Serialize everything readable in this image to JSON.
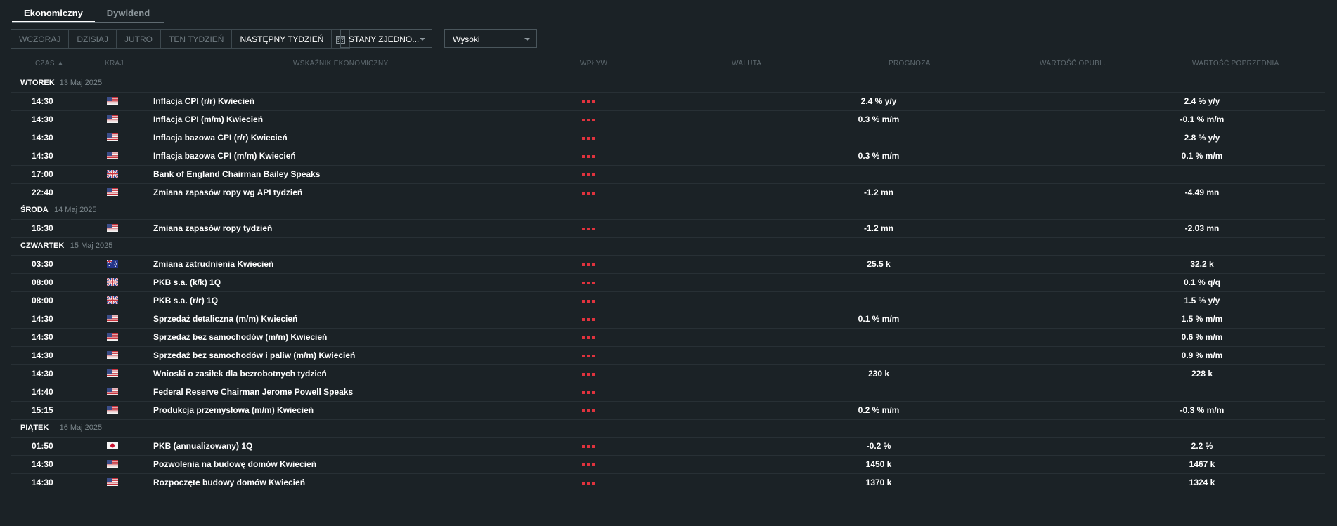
{
  "tabs": [
    "Ekonomiczny",
    "Dywidend"
  ],
  "range": [
    "WCZORAJ",
    "DZISIAJ",
    "JUTRO",
    "TEN TYDZIEŃ",
    "NASTĘPNY TYDZIEŃ"
  ],
  "calendar_icon": "calendar-icon",
  "filters": {
    "country": "STANY ZJEDNO...",
    "importance": "Wysoki"
  },
  "columns": {
    "time": "CZAS ▲",
    "country": "KRAJ",
    "indicator": "WSKAŹNIK EKONOMICZNY",
    "impact": "WPŁYW",
    "currency": "WALUTA",
    "forecast": "PROGNOZA",
    "actual": "WARTOŚĆ OPUBL.",
    "previous": "WARTOŚĆ POPRZEDNIA"
  },
  "colors": {
    "background": "#1b2226",
    "impact": "#e0333e"
  },
  "days": [
    {
      "name": "WTOREK",
      "date": "13 Maj 2025",
      "rows": [
        {
          "time": "14:30",
          "country": "us",
          "indicator": "Inflacja CPI (r/r) Kwiecień",
          "forecast": "2.4 % y/y",
          "previous": "2.4 % y/y"
        },
        {
          "time": "14:30",
          "country": "us",
          "indicator": "Inflacja CPI (m/m) Kwiecień",
          "forecast": "0.3 % m/m",
          "previous": "-0.1 % m/m"
        },
        {
          "time": "14:30",
          "country": "us",
          "indicator": "Inflacja bazowa CPI (r/r) Kwiecień",
          "forecast": "",
          "previous": "2.8 % y/y"
        },
        {
          "time": "14:30",
          "country": "us",
          "indicator": "Inflacja bazowa CPI (m/m) Kwiecień",
          "forecast": "0.3 % m/m",
          "previous": "0.1 % m/m"
        },
        {
          "time": "17:00",
          "country": "gb",
          "indicator": "Bank of England Chairman Bailey Speaks",
          "forecast": "",
          "previous": ""
        },
        {
          "time": "22:40",
          "country": "us",
          "indicator": "Zmiana zapasów ropy wg API tydzień",
          "forecast": "-1.2 mn",
          "previous": "-4.49 mn"
        }
      ]
    },
    {
      "name": "ŚRODA",
      "date": "14 Maj 2025",
      "rows": [
        {
          "time": "16:30",
          "country": "us",
          "indicator": "Zmiana zapasów ropy tydzień",
          "forecast": "-1.2 mn",
          "previous": "-2.03 mn"
        }
      ]
    },
    {
      "name": "CZWARTEK",
      "date": "15 Maj 2025",
      "rows": [
        {
          "time": "03:30",
          "country": "au",
          "indicator": "Zmiana zatrudnienia Kwiecień",
          "forecast": "25.5 k",
          "previous": "32.2 k"
        },
        {
          "time": "08:00",
          "country": "gb",
          "indicator": "PKB s.a. (k/k) 1Q",
          "forecast": "",
          "previous": "0.1 % q/q"
        },
        {
          "time": "08:00",
          "country": "gb",
          "indicator": "PKB s.a. (r/r) 1Q",
          "forecast": "",
          "previous": "1.5 % y/y"
        },
        {
          "time": "14:30",
          "country": "us",
          "indicator": "Sprzedaż detaliczna (m/m) Kwiecień",
          "forecast": "0.1 % m/m",
          "previous": "1.5 % m/m"
        },
        {
          "time": "14:30",
          "country": "us",
          "indicator": "Sprzedaż bez samochodów (m/m) Kwiecień",
          "forecast": "",
          "previous": "0.6 % m/m"
        },
        {
          "time": "14:30",
          "country": "us",
          "indicator": "Sprzedaż bez samochodów i paliw (m/m) Kwiecień",
          "forecast": "",
          "previous": "0.9 % m/m"
        },
        {
          "time": "14:30",
          "country": "us",
          "indicator": "Wnioski o zasiłek dla bezrobotnych tydzień",
          "forecast": "230 k",
          "previous": "228 k"
        },
        {
          "time": "14:40",
          "country": "us",
          "indicator": "Federal Reserve Chairman Jerome Powell Speaks",
          "forecast": "",
          "previous": ""
        },
        {
          "time": "15:15",
          "country": "us",
          "indicator": "Produkcja przemysłowa (m/m) Kwiecień",
          "forecast": "0.2 % m/m",
          "previous": "-0.3 % m/m"
        }
      ]
    },
    {
      "name": "PIĄTEK",
      "date": "16 Maj 2025",
      "rows": [
        {
          "time": "01:50",
          "country": "jp",
          "indicator": "PKB (annualizowany) 1Q",
          "forecast": "-0.2 %",
          "previous": "2.2 %"
        },
        {
          "time": "14:30",
          "country": "us",
          "indicator": "Pozwolenia na budowę domów Kwiecień",
          "forecast": "1450 k",
          "previous": "1467 k"
        },
        {
          "time": "14:30",
          "country": "us",
          "indicator": "Rozpoczęte budowy domów Kwiecień",
          "forecast": "1370 k",
          "previous": "1324 k"
        }
      ]
    }
  ]
}
